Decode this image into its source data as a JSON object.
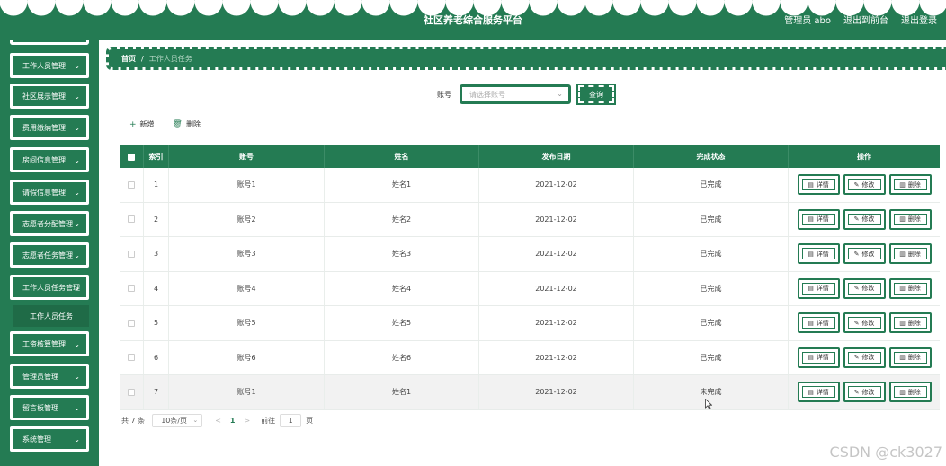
{
  "header": {
    "title": "社区养老综合服务平台",
    "user": "管理员 abo",
    "to_admin": "退出到前台",
    "logout": "退出登录"
  },
  "sidebar": {
    "items": [
      {
        "label": "工作人员管理"
      },
      {
        "label": "社区展示管理"
      },
      {
        "label": "费用缴纳管理"
      },
      {
        "label": "房间信息管理"
      },
      {
        "label": "请假信息管理"
      },
      {
        "label": "志愿者分配管理"
      },
      {
        "label": "志愿者任务管理"
      },
      {
        "label": "工作人员任务管理"
      },
      {
        "label": "工资核算管理"
      },
      {
        "label": "管理员管理"
      },
      {
        "label": "留言板管理"
      },
      {
        "label": "系统管理"
      }
    ],
    "active_sub": "工作人员任务"
  },
  "breadcrumb": {
    "home": "首页",
    "separator": "/",
    "current": "工作人员任务"
  },
  "search": {
    "label": "账号",
    "placeholder": "请选择账号",
    "button": "查询"
  },
  "toolbar": {
    "add": "新增",
    "delete": "删除"
  },
  "table": {
    "headers": {
      "index": "索引",
      "account": "账号",
      "name": "姓名",
      "date": "发布日期",
      "status": "完成状态",
      "ops": "操作"
    },
    "rows": [
      {
        "index": "1",
        "account": "账号1",
        "name": "姓名1",
        "date": "2021-12-02",
        "status": "已完成"
      },
      {
        "index": "2",
        "account": "账号2",
        "name": "姓名2",
        "date": "2021-12-02",
        "status": "已完成"
      },
      {
        "index": "3",
        "account": "账号3",
        "name": "姓名3",
        "date": "2021-12-02",
        "status": "已完成"
      },
      {
        "index": "4",
        "account": "账号4",
        "name": "姓名4",
        "date": "2021-12-02",
        "status": "已完成"
      },
      {
        "index": "5",
        "account": "账号5",
        "name": "姓名5",
        "date": "2021-12-02",
        "status": "已完成"
      },
      {
        "index": "6",
        "account": "账号6",
        "name": "姓名6",
        "date": "2021-12-02",
        "status": "已完成"
      },
      {
        "index": "7",
        "account": "账号1",
        "name": "姓名1",
        "date": "2021-12-02",
        "status": "未完成"
      }
    ],
    "op_labels": {
      "detail": "详情",
      "edit": "修改",
      "delete": "删除"
    }
  },
  "pagination": {
    "total": "共 7 条",
    "page_size": "10条/页",
    "prev": "<",
    "current_page": "1",
    "next": ">",
    "goto": "前往",
    "goto_value": "1",
    "page_unit": "页"
  },
  "watermark": "CSDN @ck3027",
  "colors": {
    "primary": "#247b53",
    "white": "#ffffff"
  },
  "icons": {
    "add": "plus-icon",
    "delete": "trash-icon",
    "detail": "file-icon",
    "edit": "pencil-icon",
    "chevron": "chevron-down-icon"
  }
}
